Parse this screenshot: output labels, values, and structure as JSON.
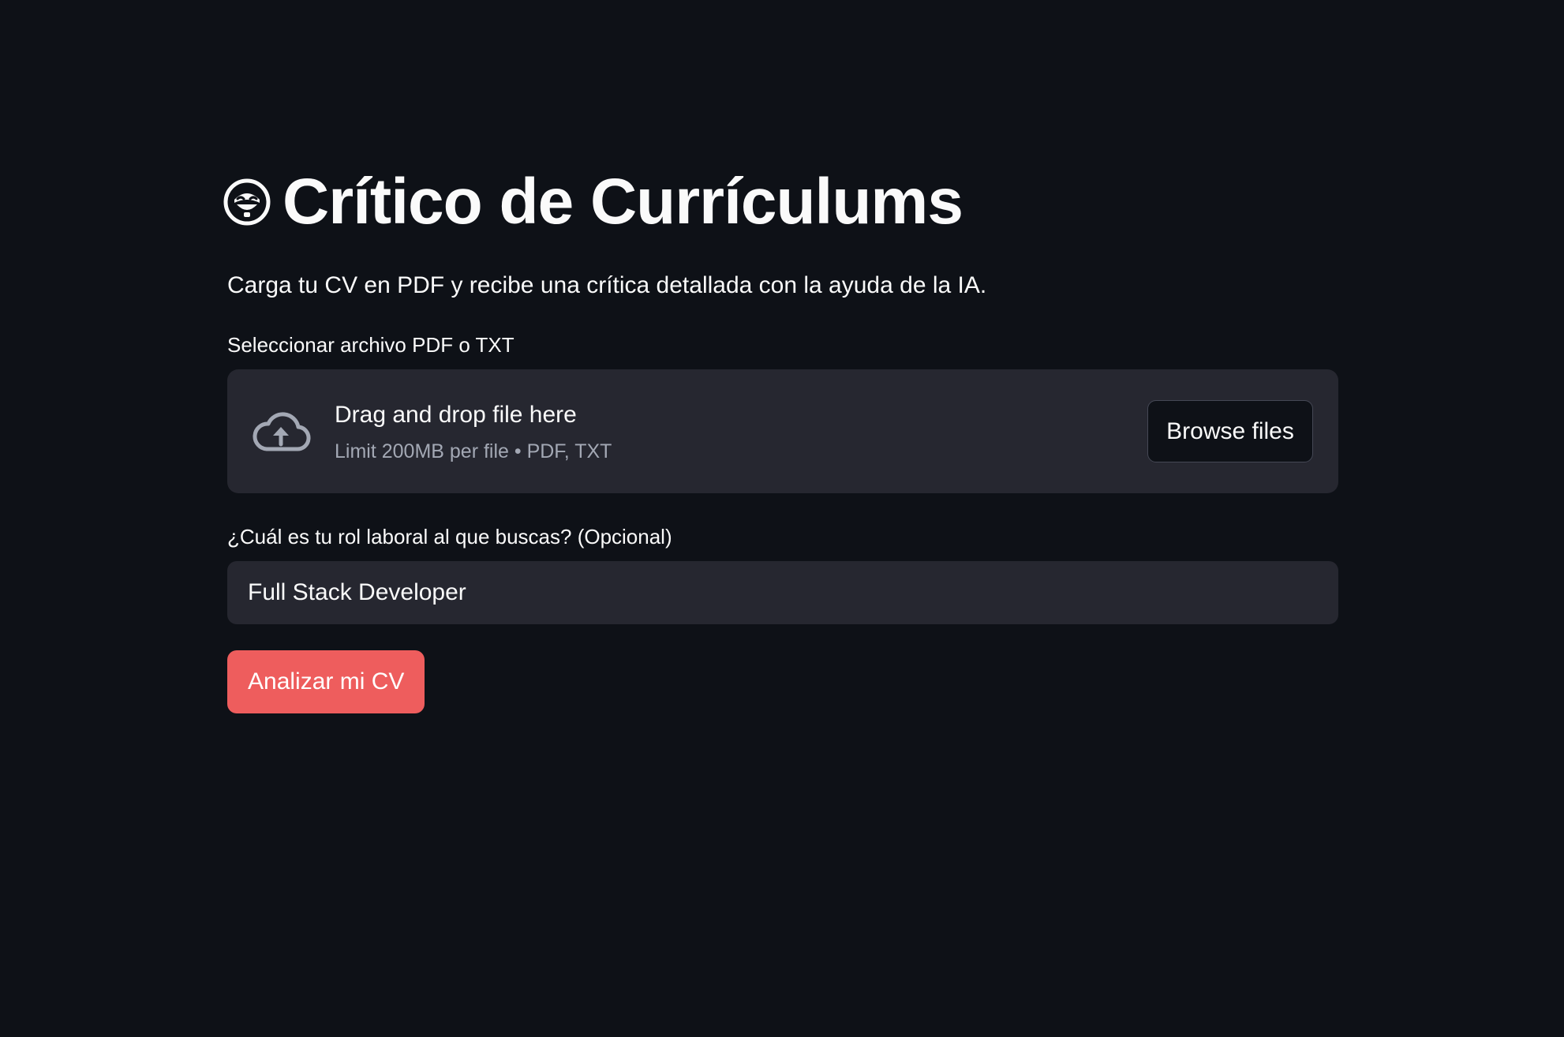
{
  "header": {
    "title": "Crítico de Currículums",
    "title_icon": "smiling-face-icon"
  },
  "subtitle": "Carga tu CV en PDF y recibe una crítica detallada con la ayuda de la IA.",
  "uploader": {
    "label": "Seleccionar archivo PDF o TXT",
    "drop_title": "Drag and drop file here",
    "limit_text": "Limit 200MB per file • PDF, TXT",
    "browse_label": "Browse files",
    "icon": "cloud-upload-icon"
  },
  "role": {
    "label": "¿Cuál es tu rol laboral al que buscas? (Opcional)",
    "value": "Full Stack Developer"
  },
  "actions": {
    "analyze_label": "Analizar mi CV"
  },
  "colors": {
    "background": "#0e1117",
    "panel": "#262730",
    "primary": "#ee5d5d",
    "text": "#fafafa",
    "muted": "#a3a8b4"
  }
}
